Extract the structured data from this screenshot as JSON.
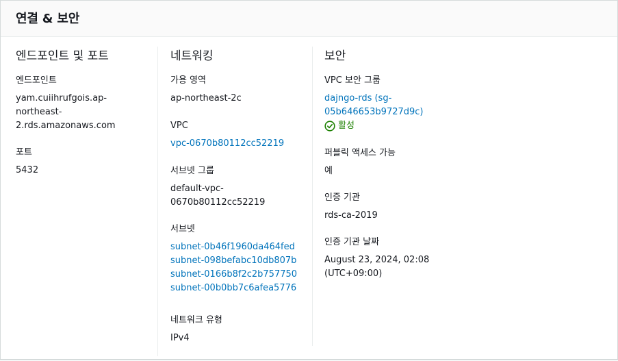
{
  "panel": {
    "title": "연결 & 보안"
  },
  "endpoint_section": {
    "heading": "엔드포인트 및 포트",
    "endpoint_label": "엔드포인트",
    "endpoint_lines": [
      "yam.cuiihrufgois.ap-",
      "northeast-",
      "2.rds.amazonaws.com"
    ],
    "port_label": "포트",
    "port_value": "5432"
  },
  "networking_section": {
    "heading": "네트워킹",
    "az_label": "가용 영역",
    "az_value": "ap-northeast-2c",
    "vpc_label": "VPC",
    "vpc_value": "vpc-0670b80112cc52219",
    "subnet_group_label": "서브넷 그룹",
    "subnet_group_lines": [
      "default-vpc-",
      "0670b80112cc52219"
    ],
    "subnets_label": "서브넷",
    "subnets": [
      "subnet-0b46f1960da464fed",
      "subnet-098befabc10db807b",
      "subnet-0166b8f2c2b757750",
      "subnet-00b0bb7c6afea5776"
    ],
    "network_type_label": "네트워크 유형",
    "network_type_value": "IPv4"
  },
  "security_section": {
    "heading": "보안",
    "vpc_sg_label": "VPC 보안 그룹",
    "vpc_sg_lines": [
      "dajngo-rds (sg-",
      "05b646653b9727d9c)"
    ],
    "sg_status": "활성",
    "public_access_label": "퍼블릭 액세스 가능",
    "public_access_value": "예",
    "ca_label": "인증 기관",
    "ca_value": "rds-ca-2019",
    "ca_date_label": "인증 기관 날짜",
    "ca_date_lines": [
      "August 23, 2024, 02:08",
      "(UTC+09:00)"
    ]
  },
  "colors": {
    "link": "#0073bb",
    "success": "#1d8102",
    "header_bg": "#fafafa",
    "border": "#d5dbdb"
  },
  "icons": {
    "status": "check-circle-icon"
  }
}
